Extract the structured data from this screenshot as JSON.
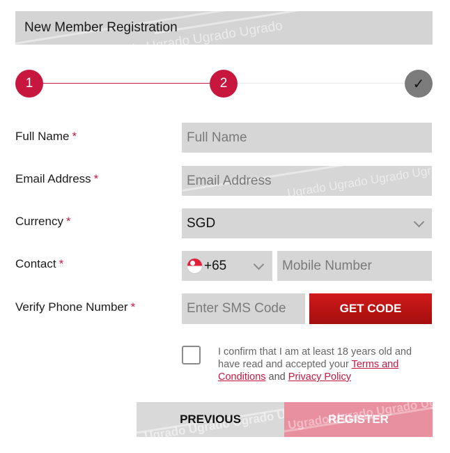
{
  "header": {
    "title": "New Member Registration",
    "watermark": "Ugrado Ugrado Ugrado Ugrado"
  },
  "stepper": {
    "steps": [
      {
        "label": "1",
        "state": "done"
      },
      {
        "label": "2",
        "state": "active"
      },
      {
        "label": "✓",
        "state": "pending"
      }
    ],
    "colors": {
      "active": "#c8173f",
      "pending": "#7b7b7b"
    }
  },
  "form": {
    "full_name": {
      "label": "Full Name",
      "required": "*",
      "placeholder": "Full Name"
    },
    "email": {
      "label": "Email Address",
      "required": "*",
      "placeholder": "Email Address"
    },
    "currency": {
      "label": "Currency",
      "required": "*",
      "value": "SGD"
    },
    "contact": {
      "label": "Contact",
      "required": "*",
      "country_code": "+65",
      "flag": "singapore-flag",
      "placeholder": "Mobile Number"
    },
    "verify": {
      "label": "Verify Phone Number",
      "required": "*",
      "placeholder": "Enter SMS Code",
      "button": "GET CODE"
    }
  },
  "consent": {
    "text_before": "I confirm that I am at least 18 years old and have read and accepted your",
    "terms_link": "Terms and Conditions",
    "and": "and",
    "privacy_link": "Privacy Policy"
  },
  "actions": {
    "previous": "PREVIOUS",
    "register": "REGISTER"
  }
}
